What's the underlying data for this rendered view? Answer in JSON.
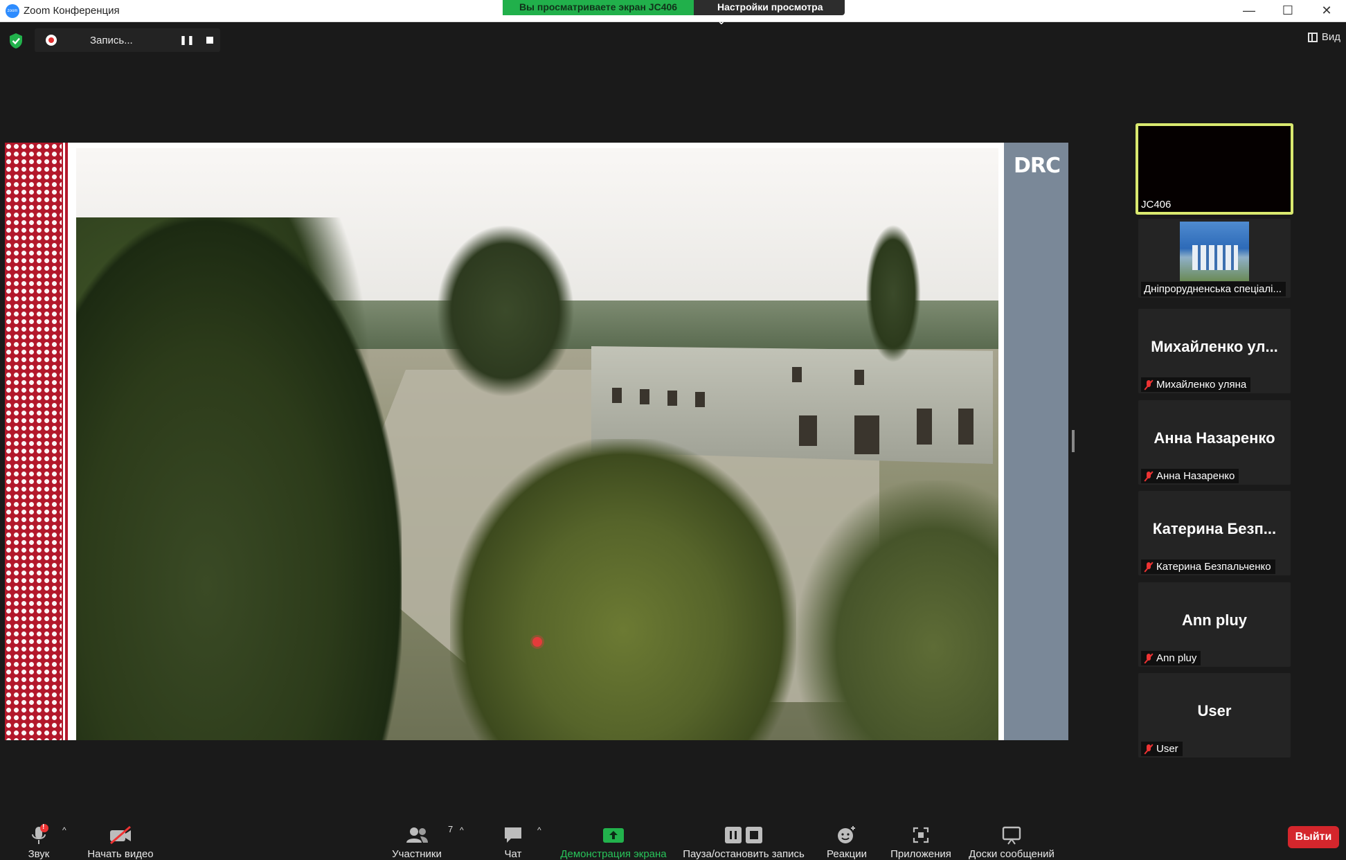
{
  "window": {
    "title": "Zoom Конференция",
    "app_icon_text": "zoom",
    "minimize": "—",
    "maximize": "☐",
    "close": "✕"
  },
  "share_banner": {
    "viewing_text": "Вы просматриваете экран JC406",
    "view_options": "Настройки просмотра ⌄"
  },
  "recording": {
    "label": "Запись...",
    "pause_glyph": "❚❚"
  },
  "view_button": {
    "label": "Вид"
  },
  "shared_screen": {
    "logo_text": "DRC"
  },
  "gallery": [
    {
      "name": "JC406",
      "big": "",
      "muted": false,
      "active": true
    },
    {
      "name": "Дніпрорудненська спеціалі...",
      "big": "",
      "muted": false,
      "active": false,
      "thumbnail": true
    },
    {
      "name": "Михайленко уляна",
      "big": "Михайленко ул...",
      "muted": true
    },
    {
      "name": "Анна Назаренко",
      "big": "Анна Назаренко",
      "muted": true
    },
    {
      "name": "Катерина Безпальченко",
      "big": "Катерина Безп...",
      "muted": true
    },
    {
      "name": "Ann pluy",
      "big": "Ann pluy",
      "muted": true
    },
    {
      "name": "User",
      "big": "User",
      "muted": true
    }
  ],
  "toolbar": {
    "audio": "Звук",
    "audio_alert": "!",
    "video": "Начать видео",
    "participants": "Участники",
    "participants_count": "7",
    "chat": "Чат",
    "share": "Демонстрация экрана",
    "pause_stop": "Пауза/остановить запись",
    "reactions": "Реакции",
    "apps": "Приложения",
    "whiteboards": "Доски сообщений",
    "leave": "Выйти",
    "caret": "^"
  },
  "colors": {
    "share_green": "#21b04b",
    "active_speaker_border": "#d9e96f",
    "leave_red": "#d4262c",
    "muted_red": "#e33333",
    "brand_red": "#b3182b"
  }
}
